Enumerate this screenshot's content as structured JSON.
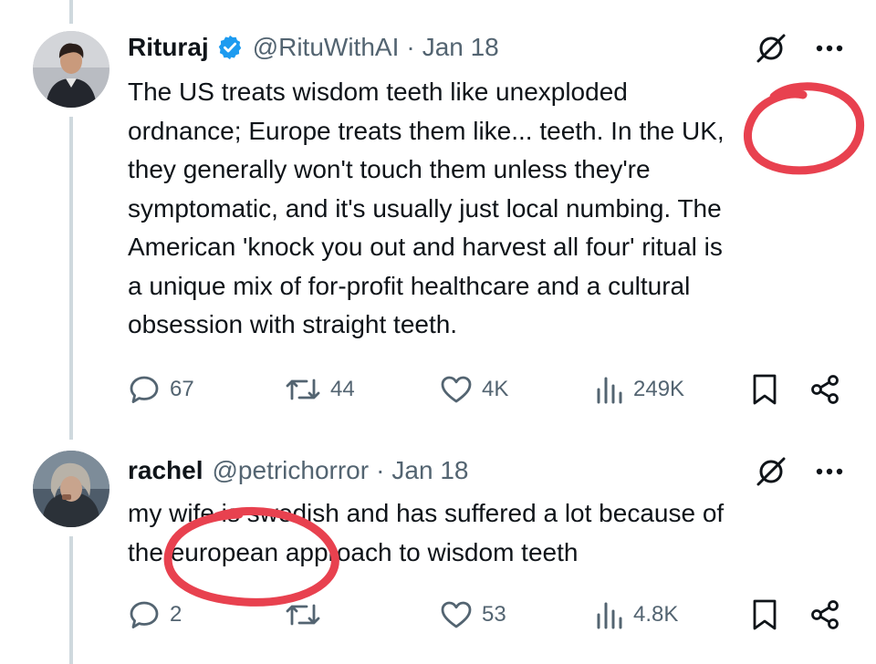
{
  "colors": {
    "text": "#0f1419",
    "secondary": "#536471",
    "verified": "#1d9bf0",
    "thread_line": "#cfd9de",
    "annotation": "#e8414f"
  },
  "tweets": [
    {
      "name": "Rituraj",
      "verified": true,
      "handle": "@RituWithAI",
      "separator": "·",
      "date": "Jan 18",
      "lines": [
        "The US treats wisdom teeth like unexploded",
        "ordnance; Europe treats them like... teeth. In the UK,",
        "they generally won't touch them unless they're",
        "symptomatic, and it's usually just local numbing. The",
        "American 'knock you out and harvest all four' ritual is",
        "a unique mix of for-profit healthcare and a cultural",
        "obsession with straight teeth."
      ],
      "replies": "67",
      "reposts": "44",
      "likes": "4K",
      "views": "249K"
    },
    {
      "name": "rachel",
      "verified": false,
      "handle": "@petrichorror",
      "separator": "·",
      "date": "Jan 18",
      "lines": [
        "my wife is swedish and has suffered a lot because of",
        "the european approach to wisdom teeth"
      ],
      "replies": "2",
      "reposts": "",
      "likes": "53",
      "views": "4.8K"
    }
  ],
  "icons": [
    "grok-icon",
    "more-icon",
    "reply-icon",
    "repost-icon",
    "like-icon",
    "views-icon",
    "bookmark-icon",
    "share-icon",
    "verified-badge-icon"
  ]
}
